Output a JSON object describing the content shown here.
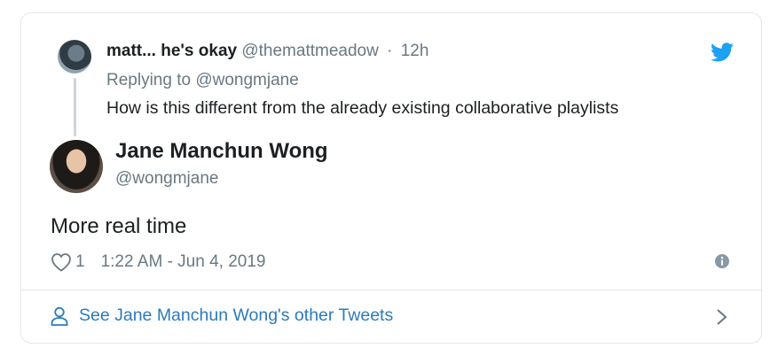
{
  "reply": {
    "author_name": "matt... he's okay",
    "handle": "@themattmeadow",
    "separator": "·",
    "time": "12h",
    "replying_to": "Replying to @wongmjane",
    "text": "How is this different from the already existing collaborative playlists"
  },
  "tweet": {
    "author_name": "Jane Manchun Wong",
    "handle": "@wongmjane",
    "text": "More real time",
    "like_count": "1",
    "timestamp": "1:22 AM - Jun 4, 2019"
  },
  "footer": {
    "link_text": "See Jane Manchun Wong's other Tweets"
  },
  "icons": {
    "brand": "twitter-bird-icon",
    "like": "heart-icon",
    "info": "info-icon",
    "user": "user-icon",
    "chevron": "chevron-right-icon"
  },
  "colors": {
    "brand_blue": "#1da1f2",
    "link_blue": "#2b7bb9",
    "text_primary": "#1c2022",
    "text_secondary": "#697882",
    "border": "#e1e8ed"
  }
}
